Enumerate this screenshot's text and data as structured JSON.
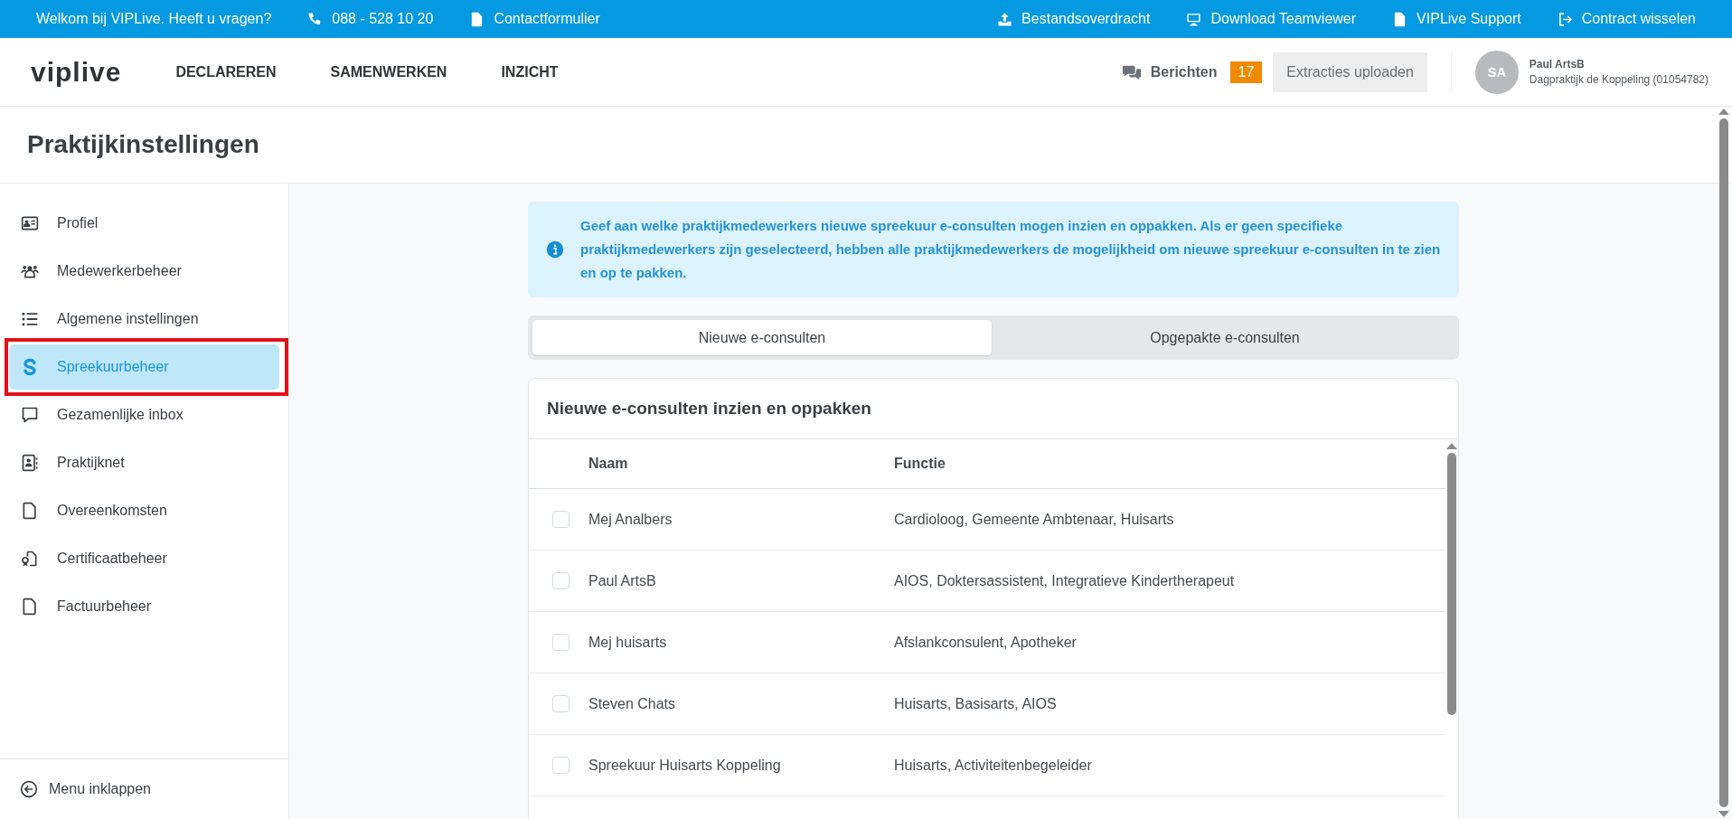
{
  "top_bar": {
    "welcome": "Welkom bij VIPLive. Heeft u vragen?",
    "left_links": [
      {
        "kind": "phone",
        "label": "088 - 528 10 20"
      },
      {
        "kind": "document",
        "label": "Contactformulier"
      }
    ],
    "right_links": [
      {
        "kind": "upload",
        "label": "Bestandsoverdracht"
      },
      {
        "kind": "monitor",
        "label": "Download Teamviewer"
      },
      {
        "kind": "document",
        "label": "VIPLive Support"
      },
      {
        "kind": "exit",
        "label": "Contract wisselen"
      }
    ]
  },
  "header": {
    "logo": "viplive",
    "nav": [
      "DECLAREREN",
      "SAMENWERKEN",
      "INZICHT"
    ],
    "messages": {
      "label": "Berichten",
      "count": "17"
    },
    "upload_button": "Extracties uploaden",
    "user": {
      "initials": "SA",
      "name": "Paul ArtsB",
      "practice": "Dagpraktijk de Koppeling (01054782)"
    }
  },
  "page_title": "Praktijkinstellingen",
  "sidebar": {
    "items": [
      {
        "kind": "id-card",
        "label": "Profiel",
        "selected": false,
        "annotated": false
      },
      {
        "kind": "users",
        "label": "Medewerkerbeheer",
        "selected": false,
        "annotated": false
      },
      {
        "kind": "list",
        "label": "Algemene instellingen",
        "selected": false,
        "annotated": false
      },
      {
        "kind": "letter-s",
        "label": "Spreekuurbeheer",
        "selected": true,
        "annotated": true
      },
      {
        "kind": "chat",
        "label": "Gezamenlijke inbox",
        "selected": false,
        "annotated": false
      },
      {
        "kind": "contact",
        "label": "Praktijknet",
        "selected": false,
        "annotated": false
      },
      {
        "kind": "file",
        "label": "Overeenkomsten",
        "selected": false,
        "annotated": false
      },
      {
        "kind": "certificate",
        "label": "Certificaatbeheer",
        "selected": false,
        "annotated": false
      },
      {
        "kind": "file",
        "label": "Factuurbeheer",
        "selected": false,
        "annotated": false
      }
    ],
    "collapse": "Menu inklappen"
  },
  "info": "Geef aan welke praktijkmedewerkers nieuwe spreekuur e-consulten mogen inzien en oppakken. Als er geen specifieke praktijkmedewerkers zijn geselecteerd, hebben alle praktijkmedewerkers de mogelijkheid om nieuwe spreekuur e-consulten in te zien en op te pakken.",
  "tabs": [
    {
      "label": "Nieuwe e-consulten",
      "selected": true
    },
    {
      "label": "Opgepakte e-consulten",
      "selected": false
    }
  ],
  "card": {
    "title": "Nieuwe e-consulten inzien en oppakken",
    "columns": [
      "Naam",
      "Functie"
    ],
    "rows": [
      {
        "checked": false,
        "name": "Mej Analbers",
        "function": "Cardioloog, Gemeente Ambtenaar, Huisarts"
      },
      {
        "checked": false,
        "name": "Paul ArtsB",
        "function": "AIOS, Doktersassistent, Integratieve Kindertherapeut"
      },
      {
        "checked": false,
        "name": "Mej huisarts",
        "function": "Afslankconsulent, Apotheker"
      },
      {
        "checked": false,
        "name": "Steven Chats",
        "function": "Huisarts, Basisarts, AIOS"
      },
      {
        "checked": false,
        "name": "Spreekuur Huisarts Koppeling",
        "function": "Huisarts, Activiteitenbegeleider"
      }
    ]
  }
}
